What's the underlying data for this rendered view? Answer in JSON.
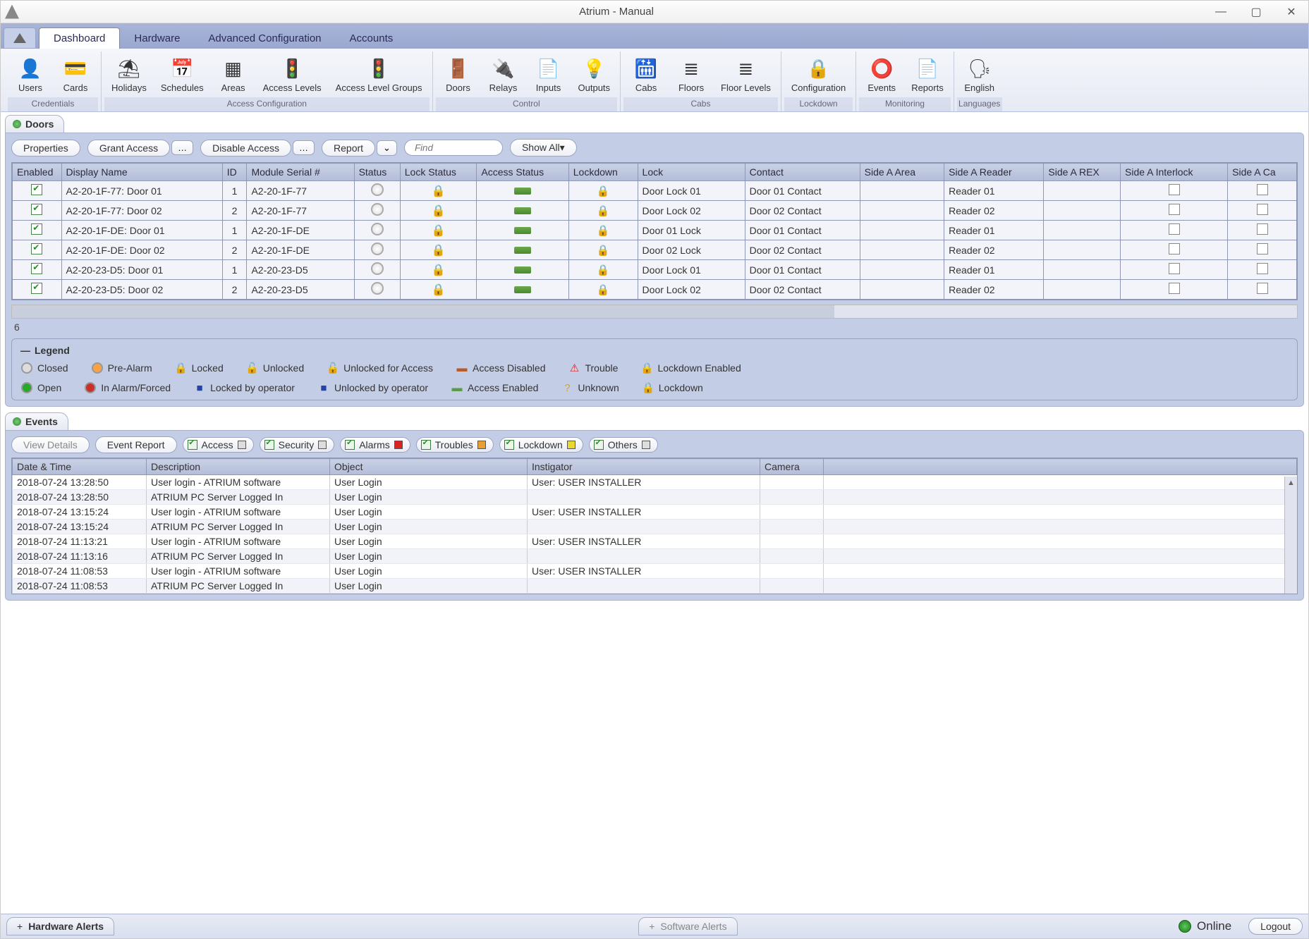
{
  "window": {
    "title": "Atrium - Manual"
  },
  "tabs": {
    "dashboard": "Dashboard",
    "hardware": "Hardware",
    "adv": "Advanced Configuration",
    "accounts": "Accounts"
  },
  "ribbon": {
    "groups": [
      {
        "label": "Credentials",
        "items": [
          {
            "icon": "👤",
            "label": "Users"
          },
          {
            "icon": "💳",
            "label": "Cards"
          }
        ]
      },
      {
        "label": "Access Configuration",
        "items": [
          {
            "icon": "⛱",
            "label": "Holidays"
          },
          {
            "icon": "📅",
            "label": "Schedules"
          },
          {
            "icon": "▦",
            "label": "Areas"
          },
          {
            "icon": "🚦",
            "label": "Access Levels"
          },
          {
            "icon": "🚦",
            "label": "Access Level Groups"
          }
        ]
      },
      {
        "label": "Control",
        "items": [
          {
            "icon": "🚪",
            "label": "Doors"
          },
          {
            "icon": "🔌",
            "label": "Relays"
          },
          {
            "icon": "📄",
            "label": "Inputs"
          },
          {
            "icon": "💡",
            "label": "Outputs"
          }
        ]
      },
      {
        "label": "Cabs",
        "items": [
          {
            "icon": "🛗",
            "label": "Cabs"
          },
          {
            "icon": "≣",
            "label": "Floors"
          },
          {
            "icon": "≣",
            "label": "Floor Levels"
          }
        ]
      },
      {
        "label": "Lockdown",
        "items": [
          {
            "icon": "🔒",
            "label": "Configuration"
          }
        ]
      },
      {
        "label": "Monitoring",
        "items": [
          {
            "icon": "⭕",
            "label": "Events"
          },
          {
            "icon": "📄",
            "label": "Reports"
          }
        ]
      },
      {
        "label": "Languages",
        "items": [
          {
            "icon": "🗣",
            "label": "English"
          }
        ]
      }
    ]
  },
  "doors": {
    "title": "Doors",
    "toolbar": {
      "properties": "Properties",
      "grant": "Grant Access",
      "disable": "Disable Access",
      "report": "Report",
      "find_placeholder": "Find",
      "showall": "Show All"
    },
    "columns": [
      "Enabled",
      "Display Name",
      "ID",
      "Module Serial #",
      "Status",
      "Lock Status",
      "Access Status",
      "Lockdown",
      "Lock",
      "Contact",
      "Side A Area",
      "Side A Reader",
      "Side A REX",
      "Side A Interlock",
      "Side A Ca"
    ],
    "rows": [
      {
        "enabled": true,
        "name": "A2-20-1F-77: Door 01",
        "id": "1",
        "serial": "A2-20-1F-77",
        "lock": "Door Lock 01",
        "contact": "Door 01 Contact",
        "area": "",
        "reader": "Reader 01",
        "rex": ""
      },
      {
        "enabled": true,
        "name": "A2-20-1F-77: Door 02",
        "id": "2",
        "serial": "A2-20-1F-77",
        "lock": "Door Lock 02",
        "contact": "Door 02 Contact",
        "area": "",
        "reader": "Reader 02",
        "rex": ""
      },
      {
        "enabled": true,
        "name": "A2-20-1F-DE: Door 01",
        "id": "1",
        "serial": "A2-20-1F-DE",
        "lock": "Door 01 Lock",
        "contact": "Door 01 Contact",
        "area": "",
        "reader": "Reader 01",
        "rex": ""
      },
      {
        "enabled": true,
        "name": "A2-20-1F-DE: Door 02",
        "id": "2",
        "serial": "A2-20-1F-DE",
        "lock": "Door 02 Lock",
        "contact": "Door 02 Contact",
        "area": "",
        "reader": "Reader 02",
        "rex": ""
      },
      {
        "enabled": true,
        "name": "A2-20-23-D5: Door 01",
        "id": "1",
        "serial": "A2-20-23-D5",
        "lock": "Door Lock 01",
        "contact": "Door 01 Contact",
        "area": "",
        "reader": "Reader 01",
        "rex": ""
      },
      {
        "enabled": true,
        "name": "A2-20-23-D5: Door 02",
        "id": "2",
        "serial": "A2-20-23-D5",
        "lock": "Door Lock 02",
        "contact": "Door 02 Contact",
        "area": "",
        "reader": "Reader 02",
        "rex": ""
      }
    ],
    "count": "6"
  },
  "legend": {
    "title": "Legend",
    "row1": [
      {
        "icon": "circ",
        "color": "#ddd",
        "label": "Closed"
      },
      {
        "icon": "circ",
        "color": "#f7a24a",
        "label": "Pre-Alarm"
      },
      {
        "icon": "🔒",
        "label": "Locked"
      },
      {
        "icon": "🔓",
        "label": "Unlocked"
      },
      {
        "icon": "🔓",
        "color": "#5b5",
        "label": "Unlocked for Access"
      },
      {
        "icon": "▬",
        "color": "#b85a2a",
        "label": "Access Disabled"
      },
      {
        "icon": "⚠",
        "color": "#d22",
        "label": "Trouble"
      },
      {
        "icon": "🔒",
        "color": "#888",
        "label": "Lockdown Enabled"
      }
    ],
    "row2": [
      {
        "icon": "circ",
        "color": "#2aa82a",
        "label": "Open"
      },
      {
        "icon": "circ",
        "color": "#c8302a",
        "label": "In Alarm/Forced"
      },
      {
        "icon": "■",
        "color": "#2244aa",
        "label": "Locked by operator"
      },
      {
        "icon": "■",
        "color": "#2244aa",
        "label": "Unlocked by operator"
      },
      {
        "icon": "▬",
        "color": "#5a9a4a",
        "label": "Access Enabled"
      },
      {
        "icon": "?",
        "color": "#e0a020",
        "label": "Unknown"
      },
      {
        "icon": "🔒",
        "color": "#d22",
        "label": "Lockdown"
      }
    ]
  },
  "events": {
    "title": "Events",
    "toolbar": {
      "view": "View Details",
      "report": "Event Report",
      "filters": [
        {
          "label": "Access",
          "color": "#ddd"
        },
        {
          "label": "Security",
          "color": "#ddd"
        },
        {
          "label": "Alarms",
          "color": "#d22"
        },
        {
          "label": "Troubles",
          "color": "#e8a030"
        },
        {
          "label": "Lockdown",
          "color": "#e8d830"
        },
        {
          "label": "Others",
          "color": "#ddd"
        }
      ]
    },
    "columns": [
      "Date & Time",
      "Description",
      "Object",
      "Instigator",
      "Camera",
      ""
    ],
    "rows": [
      {
        "dt": "2018-07-24 13:28:50",
        "desc": "User login - ATRIUM software",
        "obj": "User Login",
        "inst": "User: USER INSTALLER",
        "cam": ""
      },
      {
        "dt": "2018-07-24 13:28:50",
        "desc": "ATRIUM PC Server Logged In",
        "obj": "User Login",
        "inst": "",
        "cam": ""
      },
      {
        "dt": "2018-07-24 13:15:24",
        "desc": "User login - ATRIUM software",
        "obj": "User Login",
        "inst": "User: USER INSTALLER",
        "cam": ""
      },
      {
        "dt": "2018-07-24 13:15:24",
        "desc": "ATRIUM PC Server Logged In",
        "obj": "User Login",
        "inst": "",
        "cam": ""
      },
      {
        "dt": "2018-07-24 11:13:21",
        "desc": "User login - ATRIUM software",
        "obj": "User Login",
        "inst": "User: USER INSTALLER",
        "cam": ""
      },
      {
        "dt": "2018-07-24 11:13:16",
        "desc": "ATRIUM PC Server Logged In",
        "obj": "User Login",
        "inst": "",
        "cam": ""
      },
      {
        "dt": "2018-07-24 11:08:53",
        "desc": "User login - ATRIUM software",
        "obj": "User Login",
        "inst": "User: USER INSTALLER",
        "cam": ""
      },
      {
        "dt": "2018-07-24 11:08:53",
        "desc": "ATRIUM PC Server Logged In",
        "obj": "User Login",
        "inst": "",
        "cam": ""
      }
    ]
  },
  "statusbar": {
    "hardware": "Hardware Alerts",
    "software": "Software Alerts",
    "online": "Online",
    "logout": "Logout"
  }
}
